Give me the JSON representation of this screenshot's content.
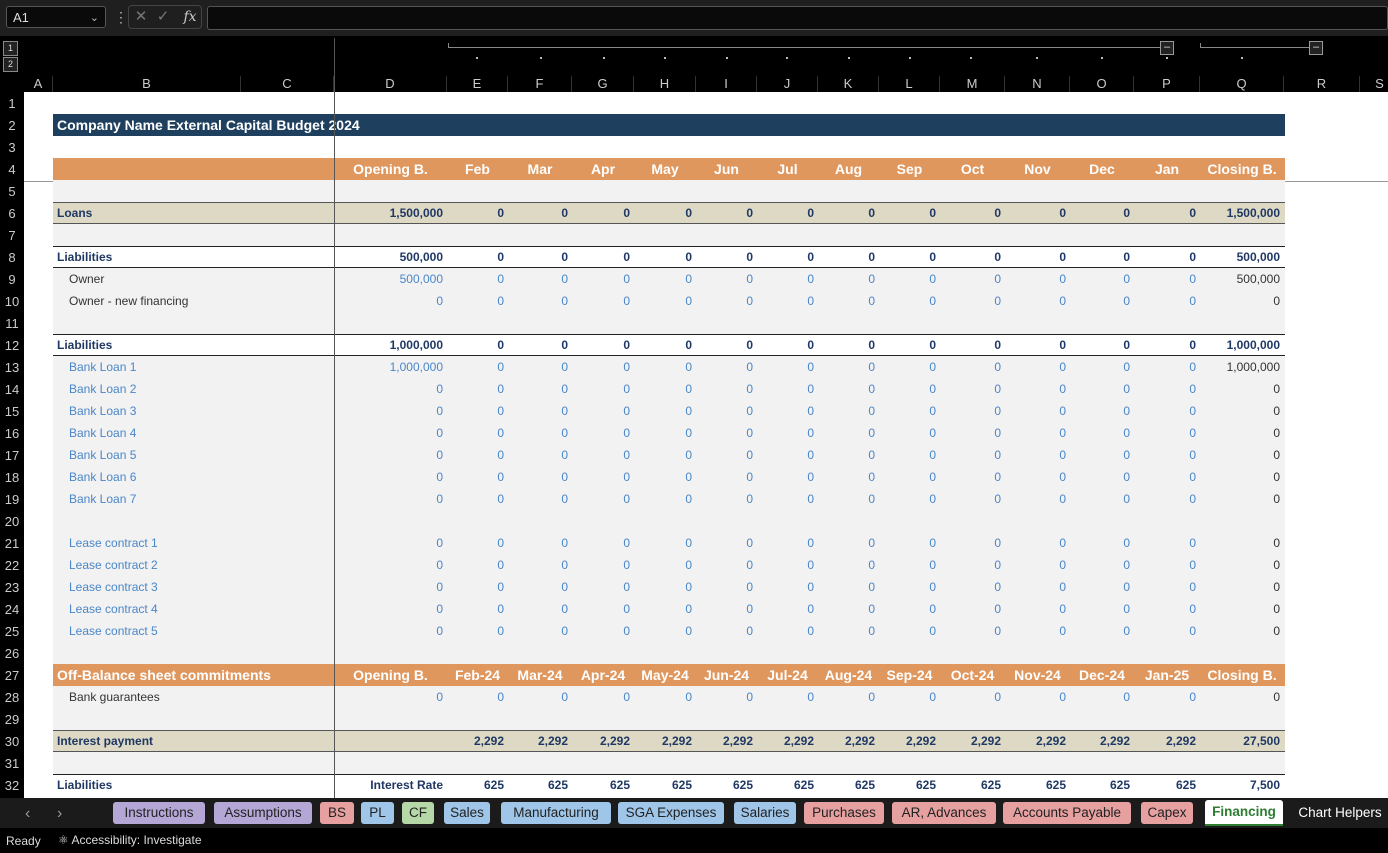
{
  "formula_bar": {
    "name_box": "A1",
    "cancel_icon": "✕",
    "enter_icon": "✓",
    "fx_label": "fx",
    "formula": ""
  },
  "outline": {
    "levels": [
      "1",
      "2"
    ]
  },
  "columns": [
    "A",
    "B",
    "C",
    "D",
    "E",
    "F",
    "G",
    "H",
    "I",
    "J",
    "K",
    "L",
    "M",
    "N",
    "O",
    "P",
    "Q",
    "R",
    "S"
  ],
  "rows": [
    "1",
    "2",
    "3",
    "4",
    "5",
    "6",
    "7",
    "8",
    "9",
    "10",
    "11",
    "12",
    "13",
    "14",
    "15",
    "16",
    "17",
    "18",
    "19",
    "20",
    "21",
    "22",
    "23",
    "24",
    "25",
    "26",
    "27",
    "28",
    "29",
    "30",
    "31",
    "32"
  ],
  "sheet": {
    "title": "Company Name External Capital Budget 2024",
    "header_row": [
      "Opening B.",
      "Feb",
      "Mar",
      "Apr",
      "May",
      "Jun",
      "Jul",
      "Aug",
      "Sep",
      "Oct",
      "Nov",
      "Dec",
      "Jan",
      "Closing B."
    ],
    "loans": {
      "label": "Loans",
      "values": [
        "1,500,000",
        "0",
        "0",
        "0",
        "0",
        "0",
        "0",
        "0",
        "0",
        "0",
        "0",
        "0",
        "0",
        "1,500,000"
      ]
    },
    "owner_section": {
      "label": "Liabilities",
      "values": [
        "500,000",
        "0",
        "0",
        "0",
        "0",
        "0",
        "0",
        "0",
        "0",
        "0",
        "0",
        "0",
        "0",
        "500,000"
      ],
      "items": [
        {
          "label": "Owner",
          "values": [
            "500,000",
            "0",
            "0",
            "0",
            "0",
            "0",
            "0",
            "0",
            "0",
            "0",
            "0",
            "0",
            "0",
            "500,000"
          ]
        },
        {
          "label": "Owner - new financing",
          "values": [
            "0",
            "0",
            "0",
            "0",
            "0",
            "0",
            "0",
            "0",
            "0",
            "0",
            "0",
            "0",
            "0",
            "0"
          ]
        }
      ]
    },
    "bank_section": {
      "label": "Liabilities",
      "values": [
        "1,000,000",
        "0",
        "0",
        "0",
        "0",
        "0",
        "0",
        "0",
        "0",
        "0",
        "0",
        "0",
        "0",
        "1,000,000"
      ],
      "items": [
        {
          "label": "Bank Loan 1",
          "values": [
            "1,000,000",
            "0",
            "0",
            "0",
            "0",
            "0",
            "0",
            "0",
            "0",
            "0",
            "0",
            "0",
            "0",
            "1,000,000"
          ]
        },
        {
          "label": "Bank Loan 2",
          "values": [
            "0",
            "0",
            "0",
            "0",
            "0",
            "0",
            "0",
            "0",
            "0",
            "0",
            "0",
            "0",
            "0",
            "0"
          ]
        },
        {
          "label": "Bank Loan 3",
          "values": [
            "0",
            "0",
            "0",
            "0",
            "0",
            "0",
            "0",
            "0",
            "0",
            "0",
            "0",
            "0",
            "0",
            "0"
          ]
        },
        {
          "label": "Bank Loan 4",
          "values": [
            "0",
            "0",
            "0",
            "0",
            "0",
            "0",
            "0",
            "0",
            "0",
            "0",
            "0",
            "0",
            "0",
            "0"
          ]
        },
        {
          "label": "Bank Loan 5",
          "values": [
            "0",
            "0",
            "0",
            "0",
            "0",
            "0",
            "0",
            "0",
            "0",
            "0",
            "0",
            "0",
            "0",
            "0"
          ]
        },
        {
          "label": "Bank Loan 6",
          "values": [
            "0",
            "0",
            "0",
            "0",
            "0",
            "0",
            "0",
            "0",
            "0",
            "0",
            "0",
            "0",
            "0",
            "0"
          ]
        },
        {
          "label": "Bank Loan 7",
          "values": [
            "0",
            "0",
            "0",
            "0",
            "0",
            "0",
            "0",
            "0",
            "0",
            "0",
            "0",
            "0",
            "0",
            "0"
          ]
        }
      ],
      "leases": [
        {
          "label": "Lease contract 1",
          "values": [
            "0",
            "0",
            "0",
            "0",
            "0",
            "0",
            "0",
            "0",
            "0",
            "0",
            "0",
            "0",
            "0",
            "0"
          ]
        },
        {
          "label": "Lease contract 2",
          "values": [
            "0",
            "0",
            "0",
            "0",
            "0",
            "0",
            "0",
            "0",
            "0",
            "0",
            "0",
            "0",
            "0",
            "0"
          ]
        },
        {
          "label": "Lease contract 3",
          "values": [
            "0",
            "0",
            "0",
            "0",
            "0",
            "0",
            "0",
            "0",
            "0",
            "0",
            "0",
            "0",
            "0",
            "0"
          ]
        },
        {
          "label": "Lease contract 4",
          "values": [
            "0",
            "0",
            "0",
            "0",
            "0",
            "0",
            "0",
            "0",
            "0",
            "0",
            "0",
            "0",
            "0",
            "0"
          ]
        },
        {
          "label": "Lease contract 5",
          "values": [
            "0",
            "0",
            "0",
            "0",
            "0",
            "0",
            "0",
            "0",
            "0",
            "0",
            "0",
            "0",
            "0",
            "0"
          ]
        }
      ]
    },
    "off_balance": {
      "label": "Off-Balance sheet commitments",
      "header": [
        "Opening B.",
        "Feb-24",
        "Mar-24",
        "Apr-24",
        "May-24",
        "Jun-24",
        "Jul-24",
        "Aug-24",
        "Sep-24",
        "Oct-24",
        "Nov-24",
        "Dec-24",
        "Jan-25",
        "Closing B."
      ],
      "item": {
        "label": "Bank guarantees",
        "values": [
          "0",
          "0",
          "0",
          "0",
          "0",
          "0",
          "0",
          "0",
          "0",
          "0",
          "0",
          "0",
          "0",
          "0"
        ]
      }
    },
    "interest": {
      "label": "Interest payment",
      "values": [
        "",
        "2,292",
        "2,292",
        "2,292",
        "2,292",
        "2,292",
        "2,292",
        "2,292",
        "2,292",
        "2,292",
        "2,292",
        "2,292",
        "2,292",
        "27,500"
      ]
    },
    "liab_interest": {
      "label": "Liabilities",
      "values": [
        "Interest Rate",
        "625",
        "625",
        "625",
        "625",
        "625",
        "625",
        "625",
        "625",
        "625",
        "625",
        "625",
        "625",
        "7,500"
      ]
    }
  },
  "tabs": [
    {
      "label": "Instructions",
      "color": "#b4a7d6"
    },
    {
      "label": "Assumptions",
      "color": "#b4a7d6"
    },
    {
      "label": "BS",
      "color": "#e6a0a0"
    },
    {
      "label": "PL",
      "color": "#9fc5e8"
    },
    {
      "label": "CF",
      "color": "#b6d7a8"
    },
    {
      "label": "Sales",
      "color": "#9fc5e8"
    },
    {
      "label": "Manufacturing",
      "color": "#9fc5e8"
    },
    {
      "label": "SGA Expenses",
      "color": "#9fc5e8"
    },
    {
      "label": "Salaries",
      "color": "#9fc5e8"
    },
    {
      "label": "Purchases",
      "color": "#e6a0a0"
    },
    {
      "label": "AR, Advances",
      "color": "#e6a0a0"
    },
    {
      "label": "Accounts Payable",
      "color": "#e6a0a0"
    },
    {
      "label": "Capex",
      "color": "#e6a0a0"
    },
    {
      "label": "Financing",
      "color": "#ffffff"
    },
    {
      "label": "Chart Helpers",
      "color": ""
    }
  ],
  "nav": {
    "prev": "‹",
    "next": "›"
  },
  "status": {
    "ready": "Ready",
    "accessibility": "Accessibility: Investigate"
  }
}
